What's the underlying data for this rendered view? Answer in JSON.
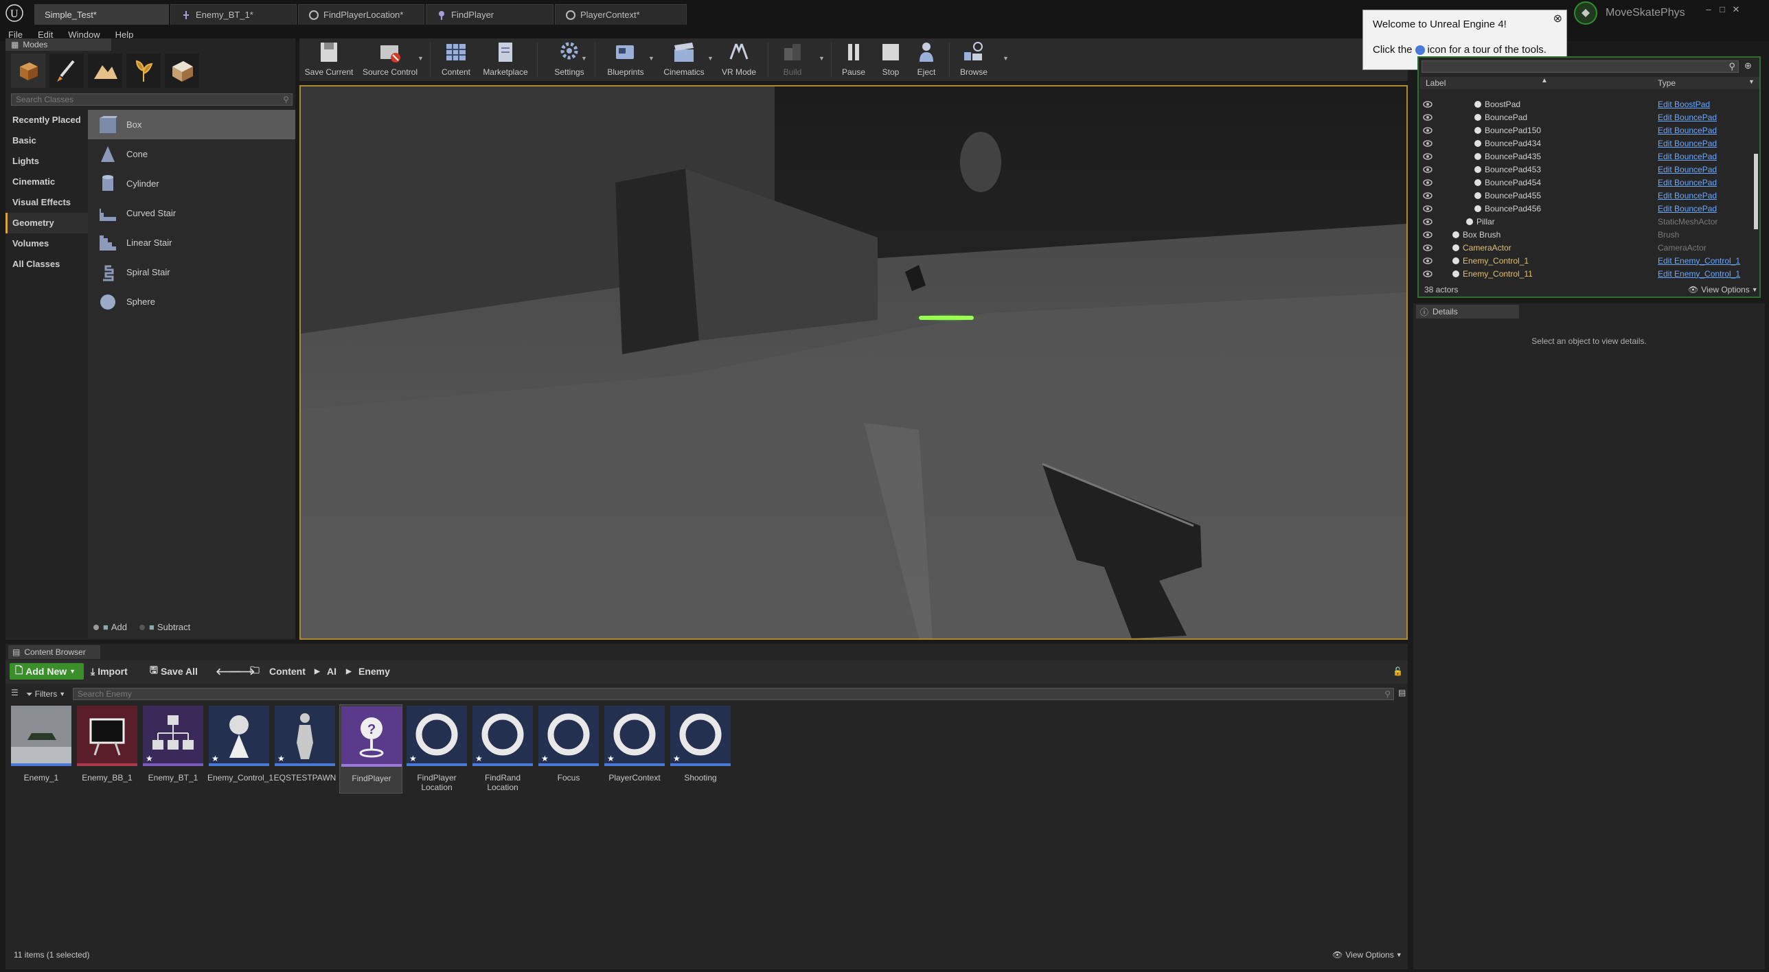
{
  "window": {
    "tabs": [
      {
        "label": "Simple_Test*",
        "active": true
      },
      {
        "label": "Enemy_BT_1*",
        "active": false
      },
      {
        "label": "FindPlayerLocation*",
        "active": false
      },
      {
        "label": "FindPlayer",
        "active": false
      },
      {
        "label": "PlayerContext*",
        "active": false
      }
    ],
    "project_name": "MoveSkatePhys"
  },
  "menu": [
    "File",
    "Edit",
    "Window",
    "Help"
  ],
  "welcome": {
    "title": "Welcome to Unreal Engine 4!",
    "line_prefix": "Click the",
    "line_suffix": "icon for a tour of the tools."
  },
  "modes": {
    "tab_label": "Modes",
    "search_placeholder": "Search Classes",
    "categories": [
      "Recently Placed",
      "Basic",
      "Lights",
      "Cinematic",
      "Visual Effects",
      "Geometry",
      "Volumes",
      "All Classes"
    ],
    "active_category": "Geometry",
    "items": [
      "Box",
      "Cone",
      "Cylinder",
      "Curved Stair",
      "Linear Stair",
      "Spiral Stair",
      "Sphere"
    ],
    "selected_item": "Box",
    "brush_add": "Add",
    "brush_subtract": "Subtract"
  },
  "toolbar": {
    "save_current": "Save Current",
    "source_control": "Source Control",
    "content": "Content",
    "marketplace": "Marketplace",
    "settings": "Settings",
    "blueprints": "Blueprints",
    "cinematics": "Cinematics",
    "vr_mode": "VR Mode",
    "build": "Build",
    "pause": "Pause",
    "stop": "Stop",
    "eject": "Eject",
    "browse": "Browse"
  },
  "outliner": {
    "col_label": "Label",
    "col_type": "Type",
    "rows": [
      {
        "label": "BoostPad",
        "type": "Edit BoostPad",
        "link": true
      },
      {
        "label": "BouncePad",
        "type": "Edit BouncePad",
        "link": true
      },
      {
        "label": "BouncePad150",
        "type": "Edit BouncePad",
        "link": true
      },
      {
        "label": "BouncePad434",
        "type": "Edit BouncePad",
        "link": true
      },
      {
        "label": "BouncePad435",
        "type": "Edit BouncePad",
        "link": true
      },
      {
        "label": "BouncePad453",
        "type": "Edit BouncePad",
        "link": true
      },
      {
        "label": "BouncePad454",
        "type": "Edit BouncePad",
        "link": true
      },
      {
        "label": "BouncePad455",
        "type": "Edit BouncePad",
        "link": true
      },
      {
        "label": "BouncePad456",
        "type": "Edit BouncePad",
        "link": true
      },
      {
        "label": "Pillar",
        "type": "StaticMeshActor",
        "link": false
      },
      {
        "label": "Box Brush",
        "type": "Brush",
        "link": false
      },
      {
        "label": "CameraActor",
        "type": "CameraActor",
        "link": false
      },
      {
        "label": "Enemy_Control_1",
        "type": "Edit Enemy_Control_1",
        "link": true
      },
      {
        "label": "Enemy_Control_11",
        "type": "Edit Enemy_Control_1",
        "link": true
      }
    ],
    "actor_count": "38 actors",
    "view_options": "View Options"
  },
  "details": {
    "tab_label": "Details",
    "empty_text": "Select an object to view details."
  },
  "content_browser": {
    "tab_label": "Content Browser",
    "add_new": "Add New",
    "import": "Import",
    "save_all": "Save All",
    "path": [
      "Content",
      "AI",
      "Enemy"
    ],
    "filters": "Filters",
    "search_placeholder": "Search Enemy",
    "assets": [
      {
        "name": "Enemy_1",
        "kind": "mesh"
      },
      {
        "name": "Enemy_BB_1",
        "kind": "blackboard"
      },
      {
        "name": "Enemy_BT_1",
        "kind": "behaviortree"
      },
      {
        "name": "Enemy_Control_1",
        "kind": "controller"
      },
      {
        "name": "EQSTESTPAWN",
        "kind": "pawn"
      },
      {
        "name": "FindPlayer",
        "kind": "eqs"
      },
      {
        "name": "FindPlayer Location",
        "kind": "ring"
      },
      {
        "name": "FindRand Location",
        "kind": "ring"
      },
      {
        "name": "Focus",
        "kind": "ring"
      },
      {
        "name": "PlayerContext",
        "kind": "ring"
      },
      {
        "name": "Shooting",
        "kind": "ring"
      }
    ],
    "selected_asset": "FindPlayer",
    "status": "11 items (1 selected)",
    "view_options": "View Options"
  }
}
